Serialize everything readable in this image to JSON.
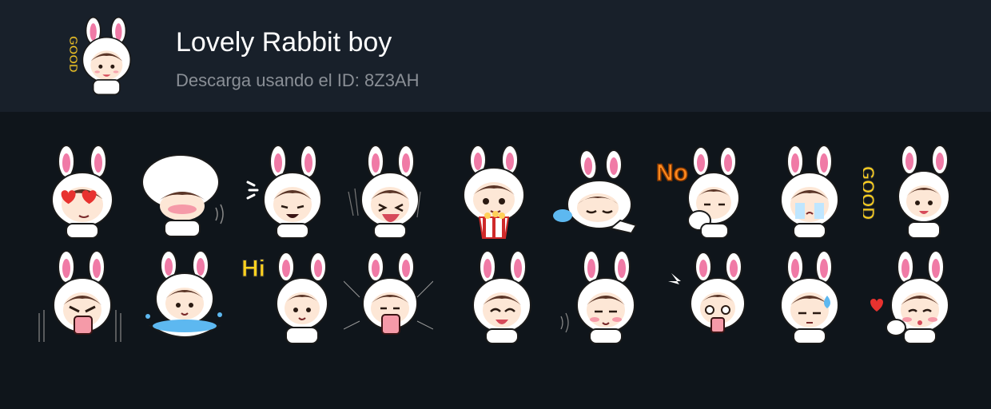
{
  "colors": {
    "header_bg": "#18202a",
    "page_bg": "#0f151b",
    "title": "#ffffff",
    "subtitle": "#8a8f96",
    "ear_inner": "#f07aa6",
    "hood": "#ffffff",
    "hair": "#5a3527",
    "skin": "#fde7d6",
    "cheek": "#f7a7b0"
  },
  "header": {
    "title": "Lovely Rabbit boy",
    "subtitle": "Descarga usando el ID: 8Z3AH",
    "icon_caption": "GOOD"
  },
  "stickers": [
    {
      "variant": "heart-eyes"
    },
    {
      "variant": "covering-face"
    },
    {
      "variant": "crying-talk"
    },
    {
      "variant": "laughing"
    },
    {
      "variant": "popcorn"
    },
    {
      "variant": "sleeping"
    },
    {
      "variant": "no",
      "caption": "No"
    },
    {
      "variant": "crying-tears"
    },
    {
      "variant": "good",
      "caption": "GOOD"
    },
    {
      "variant": "angry-shout"
    },
    {
      "variant": "bathing"
    },
    {
      "variant": "hi",
      "caption": "Hi"
    },
    {
      "variant": "shouting"
    },
    {
      "variant": "laughing-eyes-closed"
    },
    {
      "variant": "blushing-sweat"
    },
    {
      "variant": "surprised"
    },
    {
      "variant": "sweat-drop"
    },
    {
      "variant": "kiss-heart"
    }
  ]
}
